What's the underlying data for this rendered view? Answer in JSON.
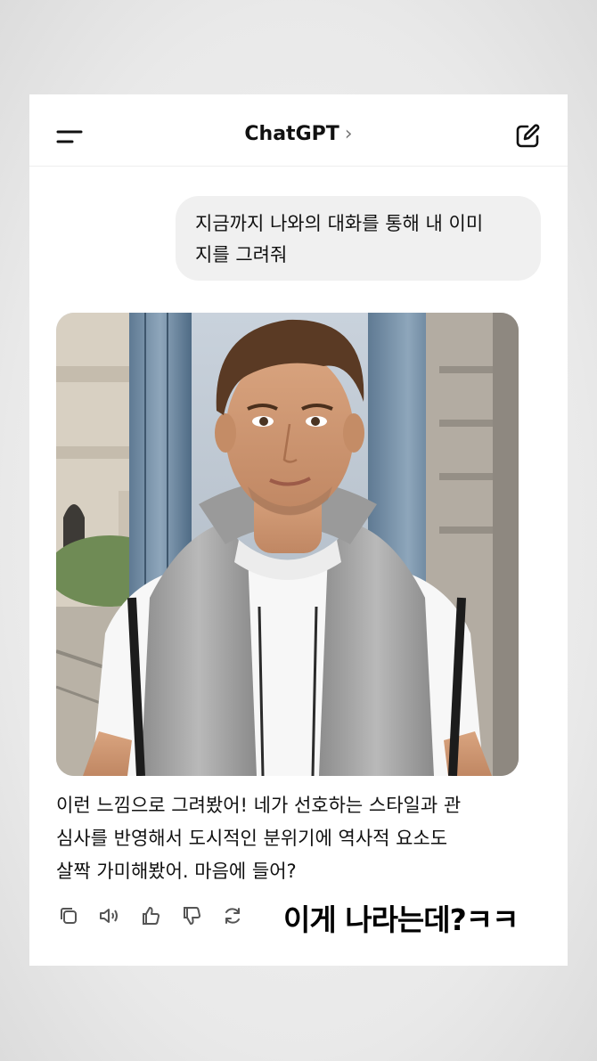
{
  "header": {
    "title": "ChatGPT",
    "chevron": "›",
    "menu_icon": "menu-icon",
    "edit_icon": "new-chat-icon"
  },
  "conversation": {
    "user_message": "지금까지 나와의 대화를 통해 내 이미\n지를 그려줘",
    "assistant_reply": "이런 느낌으로 그려봤어! 네가 선호하는 스타일과 관\n심사를 반영해서 도시적인 분위기에 역사적 요소도\n살짝 가미해봤어. 마음에 들어?",
    "generated_image": "portrait of a man in a white t-shirt and gray hooded vest on a city street"
  },
  "actions": [
    "copy-icon",
    "speaker-icon",
    "thumbs-up-icon",
    "thumbs-down-icon",
    "regenerate-icon"
  ],
  "overlay_caption": "이게 나라는데?ㅋㅋ",
  "colors": {
    "card": "#ffffff",
    "user_bubble": "#f0f0f0",
    "text": "#111111",
    "icon": "#555555"
  }
}
